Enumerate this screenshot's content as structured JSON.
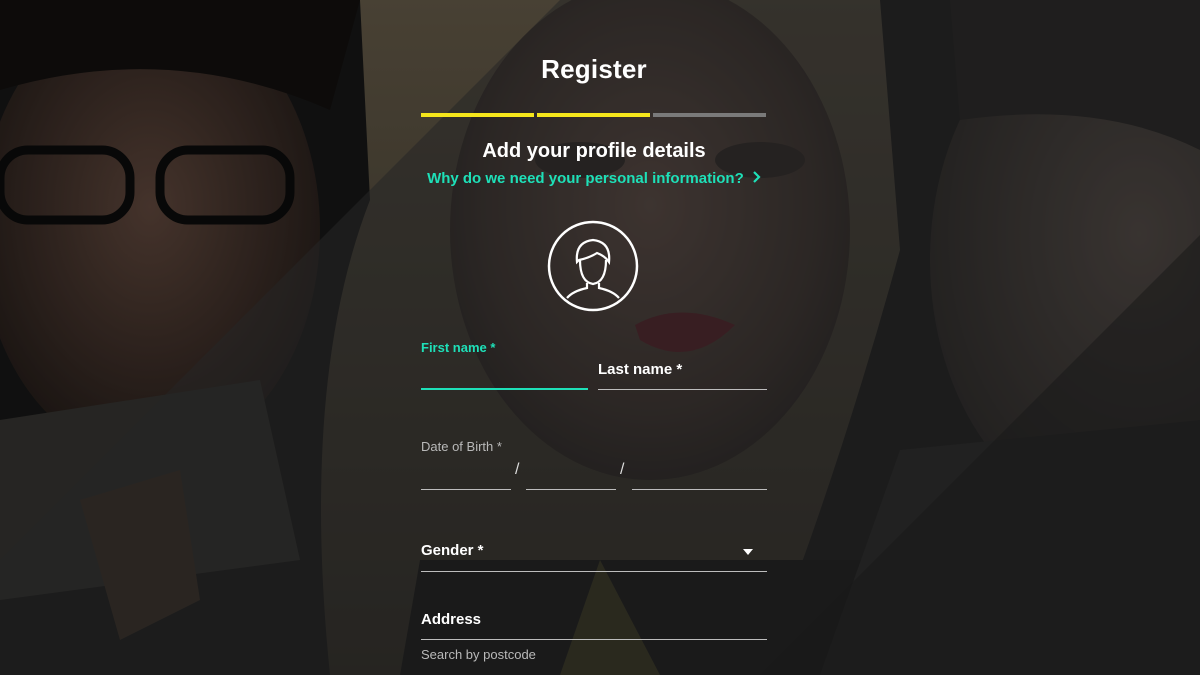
{
  "page": {
    "title": "Register",
    "subtitle": "Add your profile details",
    "why_link": "Why do we need your personal information?",
    "why_link_icon": "chevron-right-icon"
  },
  "progress": {
    "steps_total": 3,
    "steps_done": 2,
    "done_color": "#f5e61b",
    "todo_color": "#7a7a7a"
  },
  "avatar": {
    "icon": "user-avatar-icon"
  },
  "fields": {
    "first_name": {
      "label": "First name *",
      "value": ""
    },
    "last_name": {
      "label": "Last name *",
      "value": ""
    },
    "dob": {
      "label": "Date of Birth *",
      "separator": "/",
      "day": "",
      "month": "",
      "year": ""
    },
    "gender": {
      "label": "Gender *",
      "value": ""
    },
    "address": {
      "label": "Address",
      "value": "",
      "helper": "Search by postcode"
    }
  },
  "colors": {
    "accent": "#1ee0b8",
    "progress_active": "#f5e61b",
    "background": "#1c1c1c"
  }
}
